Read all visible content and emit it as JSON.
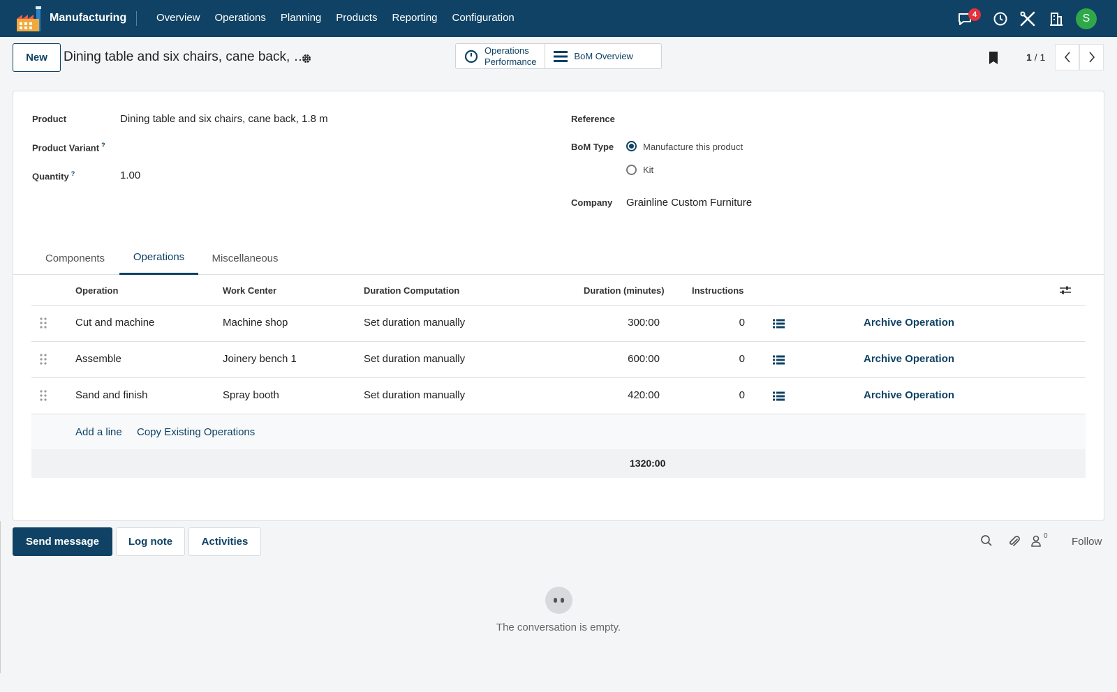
{
  "navbar": {
    "app_name": "Manufacturing",
    "menu": [
      "Overview",
      "Operations",
      "Planning",
      "Products",
      "Reporting",
      "Configuration"
    ],
    "messages_badge": "4",
    "avatar_letter": "S",
    "bg_color": "#0f4264"
  },
  "control": {
    "new_label": "New",
    "record_title": "Dining table and six chairs, cane back, …",
    "smart_ops_line1": "Operations",
    "smart_ops_line2": "Performance",
    "smart_bom": "BoM Overview",
    "pager_current": "1",
    "pager_total": "/ 1"
  },
  "form": {
    "product_label": "Product",
    "product_value": "Dining table and six chairs, cane back, 1.8 m",
    "variant_label": "Product Variant",
    "quantity_label": "Quantity",
    "quantity_value": "1.00",
    "help_mark": "?",
    "reference_label": "Reference",
    "bom_type_label": "BoM Type",
    "bom_type_options": [
      "Manufacture this product",
      "Kit"
    ],
    "bom_type_selected": "Manufacture this product",
    "company_label": "Company",
    "company_value": "Grainline Custom Furniture"
  },
  "tabs": [
    "Components",
    "Operations",
    "Miscellaneous"
  ],
  "active_tab": "Operations",
  "table": {
    "headers": {
      "operation": "Operation",
      "work_center": "Work Center",
      "duration_computation": "Duration Computation",
      "duration": "Duration (minutes)",
      "instructions": "Instructions"
    },
    "rows": [
      {
        "operation": "Cut and machine",
        "work_center": "Machine shop",
        "computation": "Set duration manually",
        "duration": "300:00",
        "instructions": "0",
        "action": "Archive Operation"
      },
      {
        "operation": "Assemble",
        "work_center": "Joinery bench 1",
        "computation": "Set duration manually",
        "duration": "600:00",
        "instructions": "0",
        "action": "Archive Operation"
      },
      {
        "operation": "Sand and finish",
        "work_center": "Spray booth",
        "computation": "Set duration manually",
        "duration": "420:00",
        "instructions": "0",
        "action": "Archive Operation"
      }
    ],
    "add_line": "Add a line",
    "copy_existing": "Copy Existing Operations",
    "total_duration": "1320:00"
  },
  "chatter": {
    "send_message": "Send message",
    "log_note": "Log note",
    "activities": "Activities",
    "followers_count": "0",
    "follow": "Follow",
    "empty_text": "The conversation is empty."
  }
}
